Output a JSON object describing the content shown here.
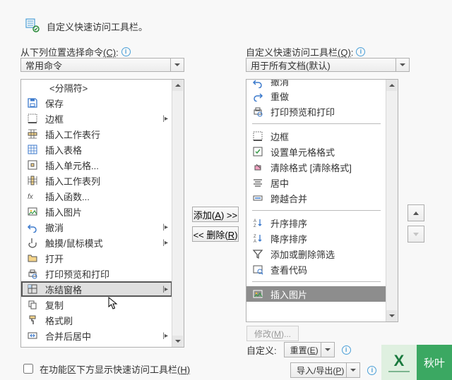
{
  "title": "自定义快速访问工具栏。",
  "left_label": {
    "text": "从下列位置选择命令",
    "accel": "(C)",
    "suffix": ":"
  },
  "right_label": {
    "text": "自定义快速访问工具栏",
    "accel": "(Q)",
    "suffix": ":"
  },
  "left_combo": "常用命令",
  "right_combo": "用于所有文档(默认)",
  "left_items": [
    {
      "label": "<分隔符>",
      "kind": "separator"
    },
    {
      "icon": "save",
      "label": "保存"
    },
    {
      "icon": "border",
      "label": "边框",
      "submenu": true
    },
    {
      "icon": "sheetrow",
      "label": "插入工作表行"
    },
    {
      "icon": "table",
      "label": "插入表格"
    },
    {
      "icon": "cellinsert",
      "label": "插入单元格..."
    },
    {
      "icon": "sheetcol",
      "label": "插入工作表列"
    },
    {
      "icon": "fx",
      "label": "插入函数..."
    },
    {
      "icon": "picture",
      "label": "插入图片"
    },
    {
      "icon": "undo",
      "label": "撤消",
      "submenu": true
    },
    {
      "icon": "touch",
      "label": "触摸/鼠标模式",
      "submenu": true
    },
    {
      "icon": "open",
      "label": "打开"
    },
    {
      "icon": "printpreview2",
      "label": "打印预览和打印"
    },
    {
      "icon": "freeze",
      "label": "冻结窗格",
      "submenu": true,
      "highlight": true
    },
    {
      "icon": "copy",
      "label": "复制"
    },
    {
      "icon": "formatpainter",
      "label": "格式刷"
    },
    {
      "icon": "mergecenter",
      "label": "合并后居中",
      "submenu": true
    }
  ],
  "right_items": [
    {
      "icon": "undo2",
      "label": "撤消",
      "truncatedTop": true
    },
    {
      "icon": "redo",
      "label": "重做"
    },
    {
      "icon": "printpreview",
      "label": "打印预览和打印"
    },
    {
      "kind": "divider"
    },
    {
      "icon": "border",
      "label": "边框"
    },
    {
      "icon": "cellformat",
      "label": "设置单元格格式"
    },
    {
      "icon": "clearformat",
      "label": "清除格式 [清除格式]"
    },
    {
      "icon": "center",
      "label": "居中"
    },
    {
      "icon": "mergeacross",
      "label": "跨越合并"
    },
    {
      "kind": "divider"
    },
    {
      "icon": "sortasc",
      "label": "升序排序"
    },
    {
      "icon": "sortdesc",
      "label": "降序排序"
    },
    {
      "icon": "filter",
      "label": "添加或删除筛选"
    },
    {
      "icon": "viewcode",
      "label": "查看代码"
    },
    {
      "kind": "divider"
    },
    {
      "icon": "picture",
      "label": "插入图片",
      "dark": true
    }
  ],
  "add_btn": "添加(A) >>",
  "remove_btn": "<< 删除(R)",
  "modify_btn": "修改(M)...",
  "custom_label": "自定义:",
  "reset_combo": "重置(E)",
  "importexport_combo": "导入/导出(P)",
  "checkbox_label": {
    "text": "在功能区下方显示快速访问工具栏",
    "accel": "(H)"
  },
  "watermark": {
    "logo": "X",
    "name": "秋叶"
  }
}
